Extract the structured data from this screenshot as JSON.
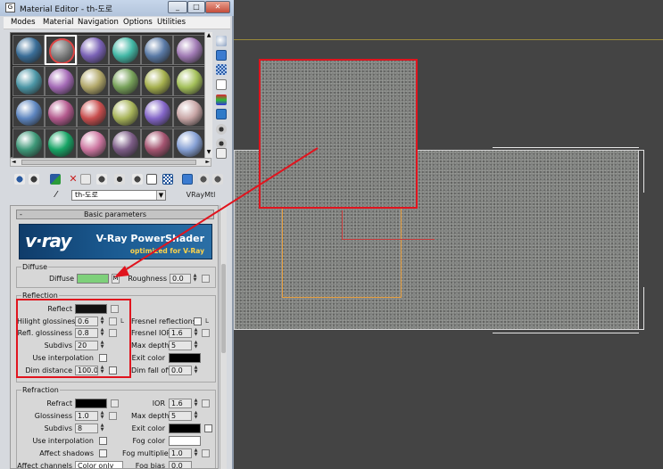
{
  "window": {
    "title": "Material Editor - th-도로",
    "icon": "app-icon",
    "controls": [
      "_",
      "□",
      "✕"
    ]
  },
  "menu": {
    "items": [
      "Modes",
      "Material",
      "Navigation",
      "Options",
      "Utilities"
    ]
  },
  "sample_slots": {
    "rows": [
      [
        "#3a6e98",
        "#8c8c8c",
        "#7a62b6",
        "#43b8a6",
        "#5a7aa6",
        "#a07ab4"
      ],
      [
        "#4c96a6",
        "#a46ab6",
        "#b2a86a",
        "#78a25a",
        "#a6b04e",
        "#a4c05a"
      ],
      [
        "#5e86c0",
        "#b45a8e",
        "#c84e4e",
        "#a8b45a",
        "#8466c8",
        "#c8a6a6"
      ],
      [
        "#3e9878",
        "#17a465",
        "#cc76a0",
        "#7c5c86",
        "#a45470",
        "#86a0d4"
      ]
    ],
    "active": {
      "row": 0,
      "col": 1,
      "icon": "checker-sphere-icon"
    }
  },
  "side_toolbar": [
    "sample-type-icon",
    "backlight-icon",
    "background-icon",
    "uv-tiling-icon",
    "video-check-icon",
    "make-preview-icon",
    "options-icon",
    "select-by-material-icon",
    "material-map-navigator-icon"
  ],
  "bottom_toolbar": [
    "get-material-icon",
    "put-to-scene-icon",
    "assign-to-selection-icon",
    "reset-map-icon",
    "make-unique-icon",
    "put-to-library-icon",
    "material-id-channel-icon",
    "show-shaded-icon",
    "show-end-result-icon",
    "go-to-parent-icon",
    "go-forward-icon"
  ],
  "material": {
    "eyedropper": "eyedropper-icon",
    "name": "th-도로",
    "type": "VRayMtl"
  },
  "rollout": {
    "title": "Basic parameters",
    "collapse": "-"
  },
  "banner": {
    "logo": "v·ray",
    "product": "V-Ray PowerShader",
    "tagline": "optimized for V-Ray"
  },
  "diffuse": {
    "group": "Diffuse",
    "label": "Diffuse",
    "swatch_color": "#7ed07a",
    "map_button": "M",
    "roughness_label": "Roughness",
    "roughness": "0.0"
  },
  "reflection": {
    "group": "Reflection",
    "reflect_label": "Reflect",
    "reflect_color": "#111111",
    "hilight_label": "Hilight glossiness",
    "hilight": "0.6",
    "hilight_lock": "L",
    "refl_gloss_label": "Refl. glossiness",
    "refl_gloss": "0.8",
    "subdivs_label": "Subdivs",
    "subdivs": "20",
    "use_interp_label": "Use interpolation",
    "dim_dist_label": "Dim distance",
    "dim_dist": "100.0m",
    "fresnel_label": "Fresnel reflections",
    "fresnel_lock": "L",
    "fresnel_ior_label": "Fresnel IOR",
    "fresnel_ior": "1.6",
    "max_depth_label": "Max depth",
    "max_depth": "5",
    "exit_color_label": "Exit color",
    "exit_color": "#000000",
    "dim_falloff_label": "Dim fall off",
    "dim_falloff": "0.0"
  },
  "refraction": {
    "group": "Refraction",
    "refract_label": "Refract",
    "refract_color": "#000000",
    "ior_label": "IOR",
    "ior": "1.6",
    "glossiness_label": "Glossiness",
    "glossiness": "1.0",
    "max_depth_label": "Max depth",
    "max_depth": "5",
    "subdivs_label": "Subdivs",
    "subdivs": "8",
    "exit_color_label": "Exit color",
    "exit_color": "#000000",
    "use_interp_label": "Use interpolation",
    "fog_color_label": "Fog color",
    "fog_color": "#ffffff",
    "affect_shadows_label": "Affect shadows",
    "fog_mult_label": "Fog multiplier",
    "fog_mult": "1.0",
    "affect_channels_label": "Affect channels",
    "affect_channels": "Color only",
    "fog_bias_label": "Fog bias",
    "fog_bias": "0.0"
  },
  "colors": {
    "highlight": "#e0141e",
    "selection": "#e8a040",
    "viewport_bg": "#444444"
  }
}
